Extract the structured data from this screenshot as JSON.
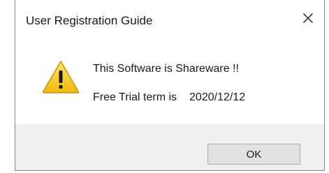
{
  "window": {
    "title": "User Registration Guide",
    "close_icon": "close-icon"
  },
  "message": {
    "icon": "warning-icon",
    "line1": "This Software is Shareware !!",
    "line2_label": "Free Trial term is",
    "line2_date": "2020/12/12"
  },
  "buttons": {
    "ok_label": "OK"
  },
  "colors": {
    "footer_bg": "#f0f0f0",
    "button_bg": "#e1e1e1",
    "button_border": "#adadad",
    "warning_fill": "#f7c928"
  }
}
